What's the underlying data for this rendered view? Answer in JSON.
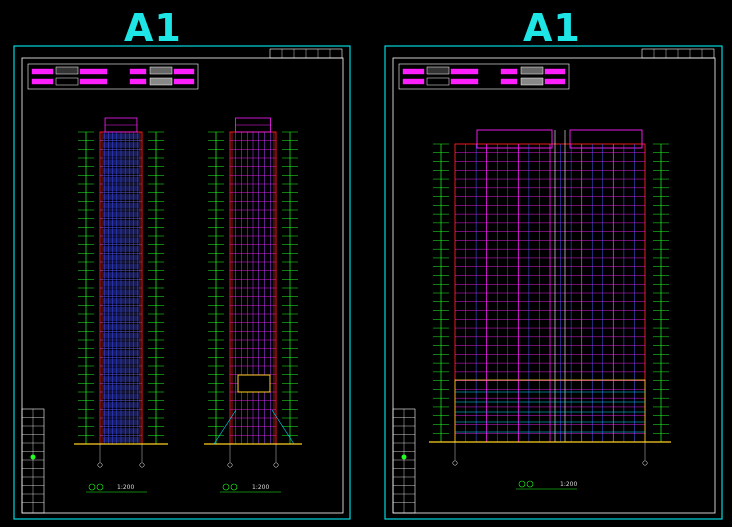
{
  "sheets": [
    {
      "size_label": "A1",
      "scale": "1:200"
    },
    {
      "size_label": "A1",
      "scale": "1:200"
    }
  ],
  "colors": {
    "border": "#00d8e0",
    "frame": "#ffffff",
    "magenta": "#ff20ff",
    "green": "#20ff20",
    "red": "#ff2020",
    "blue": "#3a48ff",
    "yellow": "#ffd020",
    "cyan": "#00e0ff"
  }
}
